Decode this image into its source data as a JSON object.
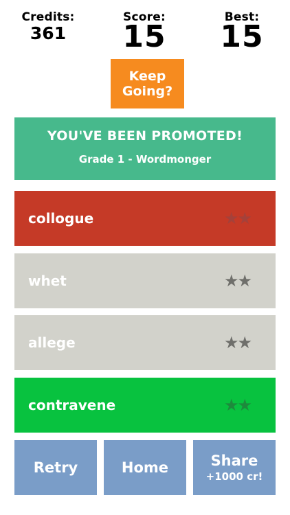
{
  "stats": {
    "credits_label": "Credits:",
    "credits_value": "361",
    "score_label": "Score:",
    "score_value": "15",
    "best_label": "Best:",
    "best_value": "15"
  },
  "keep_going": {
    "label": "Keep\nGoing?"
  },
  "promotion": {
    "title": "YOU'VE BEEN PROMOTED!",
    "subtitle": "Grade 1 - Wordmonger"
  },
  "words": [
    {
      "word": "collogue",
      "stars": "★★",
      "star_color": "#a5413a",
      "bg": "#c53a27"
    },
    {
      "word": "whet",
      "stars": "★★",
      "star_color": "#6f6f6b",
      "bg": "#d2d2cb"
    },
    {
      "word": "allege",
      "stars": "★★",
      "star_color": "#6f6f6b",
      "bg": "#d2d2cb"
    },
    {
      "word": "contravene",
      "stars": "★★",
      "star_color": "#1d8a3c",
      "bg": "#08c23f"
    }
  ],
  "buttons": {
    "retry": "Retry",
    "home": "Home",
    "share": "Share",
    "share_sub": "+1000 cr!"
  },
  "colors": {
    "keep_going": "#f68b1f",
    "promotion": "#47b98c",
    "button": "#7a9dc8"
  }
}
